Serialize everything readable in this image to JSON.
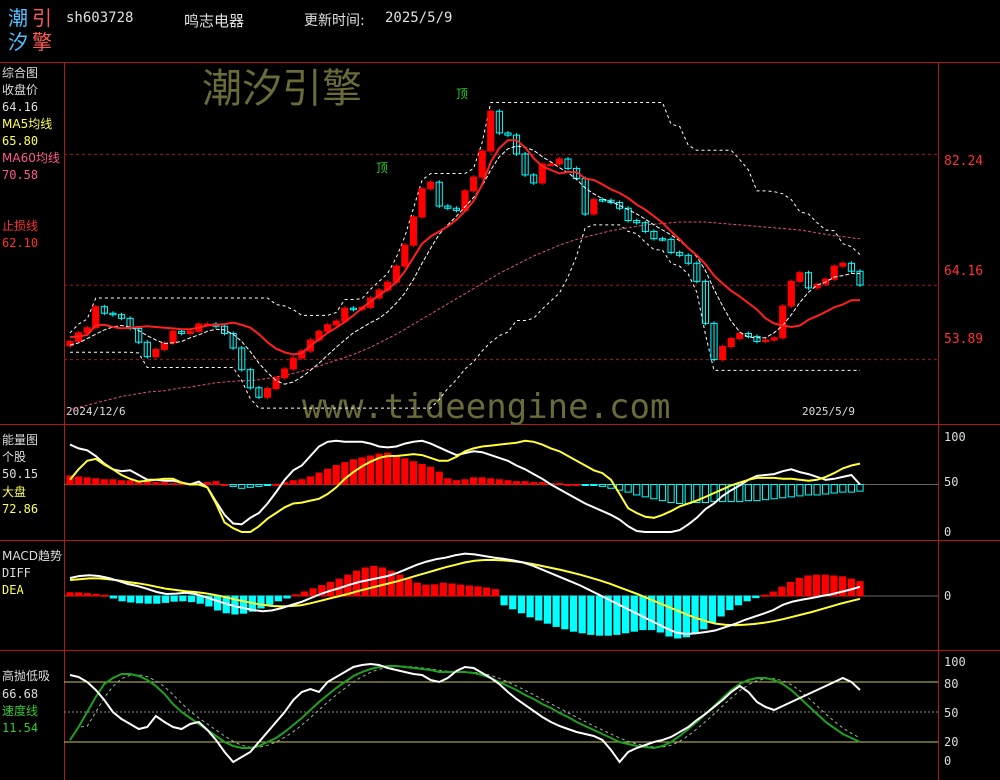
{
  "header": {
    "logo_chars": [
      "潮",
      "引",
      "汐",
      "擎"
    ],
    "code": "sh603728",
    "name": "鸣志电器",
    "update_label": "更新时间:",
    "update_date": "2025/5/9"
  },
  "watermarks": {
    "top": "潮汐引擎",
    "url": "www.tideengine.com"
  },
  "colors": {
    "up": "#ff0000",
    "down": "#00ffff",
    "ma5": "#ffffff",
    "ma60": "#ff3c3c",
    "stop": "#ff2020",
    "energy_stock": "#ffffff",
    "energy_index": "#ffff33",
    "diff": "#ffffff",
    "dea": "#ffff33",
    "kline": "#ffffff",
    "speed": "#1fa01f",
    "separator": "#b01818",
    "text": "#dddddd"
  },
  "panels": {
    "main": {
      "title": "综合图",
      "close_label": "收盘价",
      "close_value": "64.16",
      "ma5_label": "MA5均线",
      "ma5_value": "65.80",
      "ma60_label": "MA60均线",
      "ma60_value": "70.58",
      "stop_label": "止损线",
      "stop_value": "62.10",
      "date_start": "2024/12/6",
      "date_end": "2025/5/9",
      "marker_label": "顶",
      "right_axis": [
        "82.24",
        "64.16",
        "53.89"
      ]
    },
    "energy": {
      "title": "能量图",
      "stock_label": "个股",
      "stock_value": "50.15",
      "index_label": "大盘",
      "index_value": "72.86",
      "right_axis": [
        "100",
        "50",
        "0"
      ]
    },
    "macd": {
      "title": "MACD趋势",
      "diff_label": "DIFF",
      "dea_label": "DEA",
      "right_axis": [
        "0"
      ]
    },
    "kdj": {
      "title": "高抛低吸",
      "value1": "66.68",
      "speed_label": "速度线",
      "speed_value": "11.54",
      "right_axis": [
        "100",
        "80",
        "50",
        "20",
        "0"
      ]
    }
  },
  "chart_data": [
    {
      "type": "candlestick",
      "panel": "综合图",
      "x_range": [
        "2024/12/6",
        "2025/5/9"
      ],
      "reference_levels": [
        82.24,
        64.16,
        53.89
      ],
      "ylim": [
        45,
        95
      ],
      "close": [
        56.4,
        57.6,
        58.3,
        61.2,
        60.3,
        60.1,
        59.6,
        58.2,
        56.3,
        54.3,
        55.3,
        56.2,
        57.8,
        57.5,
        57.8,
        58.8,
        58.8,
        58.5,
        57.5,
        55.5,
        52.5,
        50.0,
        48.7,
        49.9,
        51.4,
        52.6,
        54.1,
        55.1,
        56.6,
        57.8,
        58.7,
        59.2,
        61.0,
        60.8,
        61.1,
        62.4,
        63.5,
        64.6,
        66.8,
        69.7,
        73.6,
        77.5,
        78.4,
        75.1,
        74.8,
        74.5,
        77.2,
        79.1,
        82.7,
        88.2,
        85.2,
        84.9,
        82.3,
        79.4,
        78.3,
        80.9,
        80.9,
        81.6,
        80.3,
        78.9,
        74.0,
        76.0,
        75.9,
        75.6,
        74.8,
        73.1,
        72.8,
        71.6,
        70.6,
        70.5,
        68.7,
        68.3,
        67.2,
        64.7,
        58.9,
        53.9,
        55.7,
        56.8,
        57.5,
        57.1,
        56.4,
        56.6,
        56.9,
        61.3,
        64.7,
        65.9,
        63.8,
        64.3,
        65.0,
        66.8,
        67.2,
        66.1,
        64.2
      ],
      "ma5": [
        55.9,
        56.2,
        56.8,
        57.4,
        58.0,
        58.4,
        58.6,
        58.4,
        57.9,
        57.2,
        56.6,
        56.1,
        56.2,
        56.4,
        56.9,
        57.3,
        57.8,
        58.1,
        58.0,
        57.4,
        56.4,
        55.0,
        53.4,
        52.1,
        51.0,
        50.5,
        50.8,
        51.5,
        52.4,
        53.4,
        54.5,
        55.6,
        56.6,
        57.6,
        58.3,
        59.0,
        59.6,
        60.5,
        61.7,
        63.1,
        65.0,
        67.2,
        69.3,
        71.2,
        72.5,
        73.7,
        75.0,
        76.3,
        77.9,
        80.1,
        81.9,
        83.0,
        83.4,
        83.2,
        82.8,
        81.9,
        81.2,
        80.4,
        79.7,
        78.8,
        77.6,
        76.8,
        76.1,
        75.7,
        75.2,
        74.6,
        74.0,
        73.3,
        72.5,
        71.8,
        71.1,
        70.3,
        69.3,
        68.1,
        66.2,
        63.6,
        61.3,
        59.2,
        57.7,
        57.0,
        56.9,
        56.9,
        57.6,
        58.6,
        60.1,
        61.8,
        63.2,
        64.2,
        64.6,
        65.3,
        65.5,
        65.8,
        65.8
      ],
      "ma60": [
        47.0,
        47.3,
        47.6,
        47.9,
        48.2,
        48.5,
        48.8,
        49.0,
        49.2,
        49.4,
        49.5,
        49.6,
        49.8,
        50.0,
        50.1,
        50.3,
        50.5,
        50.7,
        50.8,
        50.9,
        51.0,
        51.0,
        51.1,
        51.3,
        51.5,
        51.7,
        52.0,
        52.3,
        52.6,
        53.0,
        53.4,
        53.8,
        54.2,
        54.6,
        55.1,
        55.6,
        56.2,
        56.8,
        57.4,
        58.1,
        58.8,
        59.5,
        60.2,
        60.9,
        61.6,
        62.3,
        63.0,
        63.7,
        64.4,
        65.1,
        65.8,
        66.4,
        67.0,
        67.6,
        68.2,
        68.7,
        69.2,
        69.7,
        70.1,
        70.5,
        70.8,
        71.1,
        71.4,
        71.7,
        71.9,
        72.1,
        72.3,
        72.5,
        72.6,
        72.7,
        72.8,
        72.9,
        72.9,
        72.9,
        72.9,
        72.8,
        72.7,
        72.6,
        72.5,
        72.4,
        72.3,
        72.2,
        72.1,
        72.0,
        71.9,
        71.8,
        71.6,
        71.4,
        71.2,
        71.0,
        70.9,
        70.7,
        70.6
      ],
      "stop_line": [
        57.0,
        57.1,
        57.3,
        58.6,
        58.7,
        58.4,
        58.2,
        58.3,
        58.4,
        58.5,
        58.4,
        58.3,
        58.2,
        58.1,
        58.1,
        58.3,
        58.6,
        58.7,
        58.8,
        59.0,
        58.7,
        58.3,
        57.4,
        56.3,
        55.4,
        54.9,
        54.6,
        54.8,
        55.8,
        56.7,
        57.6,
        58.3,
        59.1,
        60.0,
        61.0,
        61.9,
        62.8,
        63.6,
        64.6,
        66.1,
        68.0,
        69.9,
        70.9,
        71.6,
        72.3,
        73.2,
        74.4,
        75.8,
        78.1,
        81.2,
        83.1,
        84.2,
        84.2,
        83.2,
        81.7,
        80.6,
        80.1,
        79.6,
        79.8,
        79.8,
        78.9,
        78.7,
        78.1,
        77.4,
        76.9,
        76.2,
        75.3,
        74.6,
        73.7,
        72.8,
        71.6,
        70.5,
        69.3,
        68.3,
        67.1,
        65.5,
        64.4,
        63.4,
        62.6,
        61.7,
        60.8,
        59.6,
        58.9,
        58.6,
        58.4,
        58.6,
        59.4,
        59.9,
        60.5,
        61.1,
        61.5,
        62.1,
        62.1
      ]
    },
    {
      "type": "bar+line",
      "panel": "能量图",
      "ylim": [
        0,
        100
      ],
      "bars": [
        59,
        58,
        57,
        56,
        55,
        55,
        54,
        54,
        53,
        53,
        52,
        52,
        51,
        51,
        51,
        51,
        52,
        53,
        50,
        48,
        46,
        47,
        48,
        49,
        50,
        52,
        54,
        55,
        58,
        62,
        66,
        70,
        73,
        76,
        78,
        80,
        82,
        83,
        80,
        77,
        74,
        71,
        68,
        63,
        56,
        54,
        55,
        57,
        57,
        56,
        55,
        54,
        53,
        53,
        52,
        52,
        51,
        51,
        50,
        50,
        49,
        49,
        48,
        46,
        44,
        42,
        39,
        37,
        35,
        33,
        31,
        30,
        30,
        31,
        31,
        32,
        32,
        32,
        32,
        33,
        33,
        34,
        35,
        36,
        37,
        38,
        39,
        39,
        40,
        41,
        42,
        42,
        43
      ],
      "stock_line": [
        92,
        88,
        86,
        80,
        72,
        66,
        64,
        65,
        60,
        55,
        55,
        54,
        54,
        52,
        50,
        53,
        47,
        32,
        18,
        9,
        8,
        15,
        20,
        30,
        42,
        55,
        65,
        70,
        80,
        90,
        95,
        96,
        95,
        95,
        95,
        93,
        90,
        89,
        90,
        93,
        95,
        96,
        93,
        89,
        85,
        81,
        83,
        85,
        84,
        81,
        78,
        75,
        70,
        66,
        61,
        56,
        50,
        45,
        40,
        35,
        30,
        26,
        22,
        18,
        13,
        6,
        1,
        0,
        0,
        0,
        0,
        2,
        8,
        15,
        24,
        30,
        38,
        44,
        49,
        55,
        59,
        60,
        61,
        64,
        66,
        63,
        61,
        58,
        55,
        56,
        58,
        60,
        50
      ],
      "index_line": [
        55,
        66,
        75,
        77,
        71,
        66,
        60,
        56,
        53,
        54,
        55,
        56,
        56,
        52,
        50,
        50,
        47,
        30,
        10,
        4,
        0,
        0,
        6,
        14,
        20,
        26,
        30,
        31,
        33,
        35,
        40,
        47,
        56,
        63,
        69,
        74,
        78,
        80,
        80,
        81,
        82,
        81,
        78,
        75,
        75,
        79,
        85,
        88,
        90,
        91,
        92,
        93,
        94,
        96,
        95,
        92,
        88,
        85,
        80,
        75,
        70,
        65,
        62,
        55,
        40,
        25,
        20,
        16,
        15,
        18,
        22,
        27,
        30,
        33,
        37,
        41,
        45,
        49,
        52,
        55,
        57,
        57,
        57,
        56,
        56,
        55,
        54,
        55,
        58,
        62,
        67,
        70,
        72
      ]
    },
    {
      "type": "bar+line",
      "panel": "MACD趋势",
      "ylim": [
        -1.5,
        1.5
      ],
      "macd_bars": [
        0.08,
        0.08,
        0.06,
        0.04,
        0.02,
        -0.05,
        -0.12,
        -0.15,
        -0.17,
        -0.18,
        -0.18,
        -0.16,
        -0.13,
        -0.12,
        -0.14,
        -0.18,
        -0.25,
        -0.35,
        -0.42,
        -0.45,
        -0.43,
        -0.38,
        -0.3,
        -0.21,
        -0.12,
        -0.05,
        0.03,
        0.1,
        0.18,
        0.26,
        0.34,
        0.42,
        0.52,
        0.62,
        0.7,
        0.74,
        0.7,
        0.62,
        0.52,
        0.42,
        0.32,
        0.27,
        0.28,
        0.32,
        0.3,
        0.27,
        0.25,
        0.23,
        0.2,
        0.16,
        -0.22,
        -0.32,
        -0.42,
        -0.52,
        -0.6,
        -0.68,
        -0.76,
        -0.82,
        -0.88,
        -0.92,
        -0.96,
        -0.98,
        -0.98,
        -0.96,
        -0.92,
        -0.88,
        -0.84,
        -0.84,
        -0.9,
        -1.0,
        -1.05,
        -1.02,
        -0.94,
        -0.82,
        -0.66,
        -0.5,
        -0.34,
        -0.22,
        -0.12,
        -0.04,
        0.02,
        0.1,
        0.22,
        0.34,
        0.44,
        0.5,
        0.52,
        0.52,
        0.5,
        0.48,
        0.42,
        0.36
      ],
      "diff": [
        0.45,
        0.5,
        0.52,
        0.5,
        0.45,
        0.38,
        0.3,
        0.25,
        0.18,
        0.1,
        0.05,
        0.06,
        0.08,
        0.05,
        -0.02,
        -0.1,
        -0.18,
        -0.25,
        -0.3,
        -0.35,
        -0.38,
        -0.36,
        -0.3,
        -0.22,
        -0.15,
        -0.05,
        0.05,
        0.13,
        0.2,
        0.28,
        0.35,
        0.4,
        0.45,
        0.5,
        0.58,
        0.68,
        0.78,
        0.86,
        0.92,
        0.96,
        1.02,
        1.06,
        1.04,
        1.0,
        0.96,
        0.93,
        0.89,
        0.84,
        0.76,
        0.66,
        0.56,
        0.46,
        0.36,
        0.26,
        0.14,
        0.02,
        -0.1,
        -0.22,
        -0.34,
        -0.46,
        -0.58,
        -0.7,
        -0.82,
        -0.92,
        -0.95,
        -0.93,
        -0.9,
        -0.86,
        -0.78,
        -0.7,
        -0.6,
        -0.52,
        -0.44,
        -0.35,
        -0.22,
        -0.14,
        -0.09,
        -0.05,
        0.0,
        0.04,
        0.1,
        0.16,
        0.23
      ],
      "dea": [
        0.4,
        0.42,
        0.44,
        0.44,
        0.42,
        0.39,
        0.35,
        0.32,
        0.28,
        0.23,
        0.18,
        0.15,
        0.12,
        0.1,
        0.07,
        0.03,
        -0.02,
        -0.08,
        -0.13,
        -0.18,
        -0.22,
        -0.25,
        -0.26,
        -0.25,
        -0.23,
        -0.18,
        -0.12,
        -0.06,
        0.0,
        0.06,
        0.13,
        0.19,
        0.25,
        0.31,
        0.37,
        0.44,
        0.51,
        0.58,
        0.65,
        0.72,
        0.78,
        0.84,
        0.88,
        0.9,
        0.9,
        0.89,
        0.87,
        0.84,
        0.8,
        0.75,
        0.7,
        0.65,
        0.59,
        0.53,
        0.46,
        0.39,
        0.31,
        0.22,
        0.13,
        0.04,
        -0.06,
        -0.16,
        -0.26,
        -0.36,
        -0.46,
        -0.55,
        -0.63,
        -0.69,
        -0.72,
        -0.73,
        -0.72,
        -0.7,
        -0.67,
        -0.63,
        -0.58,
        -0.52,
        -0.46,
        -0.4,
        -0.33,
        -0.26,
        -0.19,
        -0.13,
        -0.07
      ]
    },
    {
      "type": "line",
      "panel": "高抛低吸",
      "ylim": [
        0,
        100
      ],
      "k_line": [
        87,
        85,
        80,
        72,
        62,
        50,
        43,
        38,
        33,
        35,
        46,
        40,
        35,
        33,
        38,
        40,
        32,
        22,
        10,
        0,
        5,
        10,
        20,
        30,
        40,
        50,
        62,
        70,
        73,
        70,
        80,
        85,
        90,
        95,
        97,
        98,
        97,
        94,
        92,
        90,
        88,
        87,
        82,
        80,
        84,
        91,
        95,
        94,
        89,
        84,
        78,
        70,
        63,
        57,
        51,
        45,
        40,
        36,
        33,
        30,
        28,
        26,
        22,
        12,
        0,
        10,
        14,
        17,
        20,
        22,
        25,
        30,
        35,
        42,
        48,
        55,
        62,
        70,
        76,
        70,
        60,
        55,
        52,
        56,
        60,
        64,
        68,
        72,
        76,
        80,
        84,
        80,
        72
      ],
      "speed_line": [
        22,
        35,
        50,
        65,
        78,
        84,
        88,
        88,
        86,
        82,
        76,
        68,
        58,
        50,
        44,
        38,
        32,
        26,
        20,
        16,
        14,
        14,
        16,
        20,
        24,
        30,
        37,
        44,
        52,
        60,
        67,
        74,
        80,
        86,
        90,
        93,
        95,
        96,
        96,
        95,
        94,
        93,
        92,
        90,
        90,
        90,
        90,
        89,
        87,
        84,
        80,
        76,
        72,
        67,
        63,
        58,
        54,
        49,
        45,
        40,
        36,
        32,
        28,
        24,
        20,
        18,
        16,
        15,
        14,
        16,
        20,
        26,
        33,
        40,
        48,
        56,
        64,
        72,
        78,
        82,
        84,
        84,
        82,
        78,
        72,
        64,
        56,
        48,
        40,
        34,
        28,
        24,
        20
      ]
    }
  ]
}
